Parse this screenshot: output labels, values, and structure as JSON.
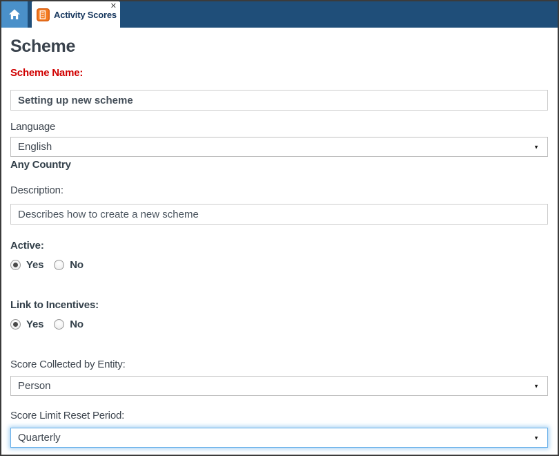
{
  "tabbar": {
    "home": {
      "icon": "home-icon"
    },
    "tab": {
      "label": "Activity Scores",
      "icon": "document-icon",
      "close_glyph": "✕"
    }
  },
  "page": {
    "title": "Scheme"
  },
  "form": {
    "scheme_name": {
      "label": "Scheme Name:",
      "value": "Setting up new scheme",
      "required": true
    },
    "language": {
      "label": "Language",
      "value": "English",
      "note": "Any Country",
      "arrow_glyph": "▼"
    },
    "description": {
      "label": "Description:",
      "value": "Describes how to create a new scheme"
    },
    "active": {
      "label": "Active:",
      "options": [
        "Yes",
        "No"
      ],
      "selected": "Yes"
    },
    "link_to_incentives": {
      "label": "Link to Incentives:",
      "options": [
        "Yes",
        "No"
      ],
      "selected": "Yes"
    },
    "score_collected_by_entity": {
      "label": "Score Collected by Entity:",
      "value": "Person",
      "arrow_glyph": "▼"
    },
    "score_limit_reset_period": {
      "label": "Score Limit Reset Period:",
      "value": "Quarterly",
      "arrow_glyph": "▼",
      "focused": true
    }
  },
  "colors": {
    "tabbar_navy": "#1F4E79",
    "home_button_blue": "#4A90C9",
    "tab_icon_orange": "#F47B20",
    "required_red": "#D00000",
    "focus_glow_blue": "#66AFE9",
    "label_gray": "#3F4750"
  }
}
